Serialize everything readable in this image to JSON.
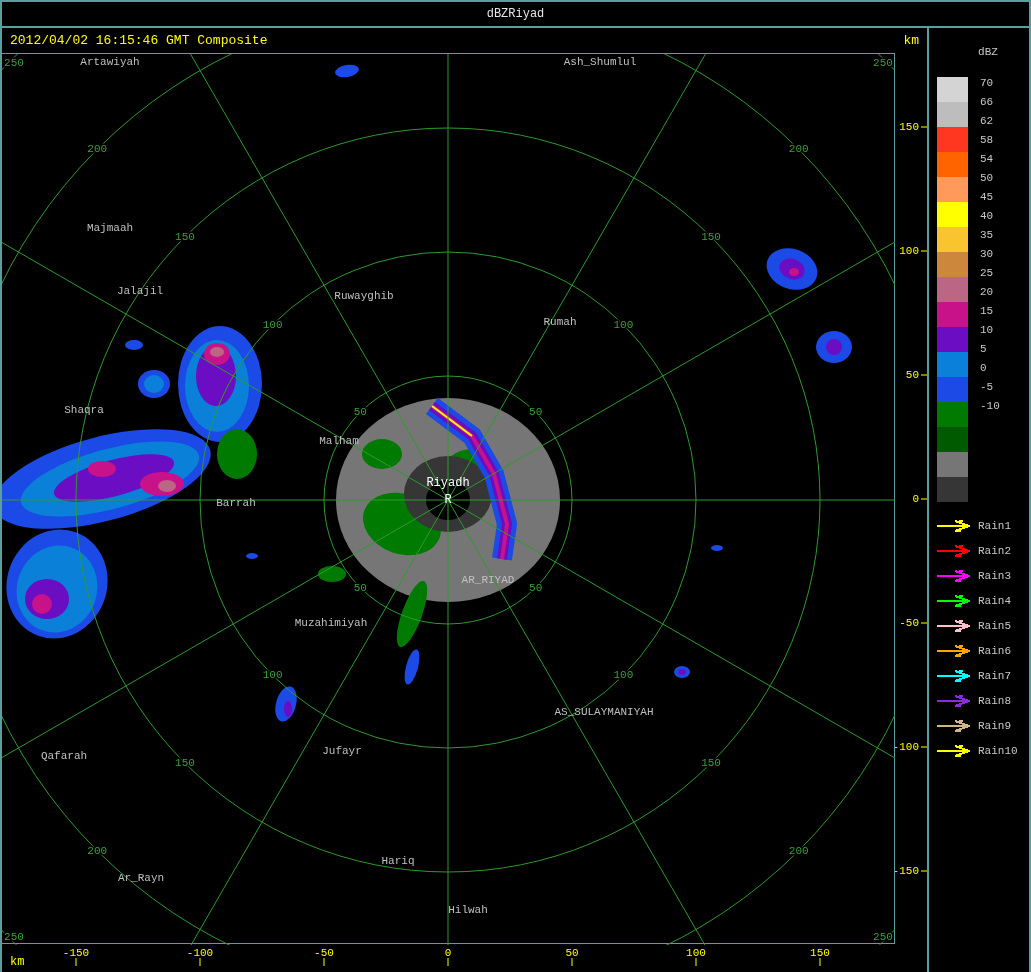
{
  "window": {
    "title": "dBZRiyad"
  },
  "header": {
    "timestamp": "2012/04/02 16:15:46 GMT Composite",
    "y_unit": "km"
  },
  "map": {
    "rings": [
      {
        "labels": [
          "50",
          "50",
          "50",
          "50"
        ]
      },
      {
        "labels": [
          "100",
          "100",
          "100",
          "100"
        ]
      },
      {
        "labels": [
          "150",
          "150",
          "150",
          "150"
        ]
      },
      {
        "labels": [
          "200",
          "200",
          "200",
          "200"
        ]
      },
      {
        "labels": [
          "250",
          "250",
          "250",
          "250"
        ]
      }
    ],
    "places": [
      {
        "name": "Artawiyah"
      },
      {
        "name": "Ash_Shumlul"
      },
      {
        "name": "Majmaah"
      },
      {
        "name": "Jalajil"
      },
      {
        "name": "Ruwayghib"
      },
      {
        "name": "Rumah"
      },
      {
        "name": "Shaqra"
      },
      {
        "name": "Malham"
      },
      {
        "name": "Barrah"
      },
      {
        "name": "AR_RIYAD"
      },
      {
        "name": "Muzahimiyah"
      },
      {
        "name": "AS_SULAYMANIYAH"
      },
      {
        "name": "Jufayr"
      },
      {
        "name": "Qafarah"
      },
      {
        "name": "Hariq"
      },
      {
        "name": "Ar_Rayn"
      },
      {
        "name": "Hilwah"
      }
    ],
    "radar_site": {
      "name": "Riyadh",
      "marker": "R"
    }
  },
  "y_axis": {
    "ticks": [
      "150",
      "100",
      "50",
      "0",
      "-50",
      "-100",
      "-150"
    ]
  },
  "x_axis": {
    "unit": "km",
    "ticks": [
      "-150",
      "-100",
      "-50",
      "0",
      "50",
      "100",
      "150"
    ]
  },
  "legend": {
    "unit": "dBZ",
    "levels": [
      {
        "color": "#d4d4d4"
      },
      {
        "color": "#bdbdbd"
      },
      {
        "color": "#ff3720"
      },
      {
        "color": "#ff6400"
      },
      {
        "color": "#ff9a5a"
      },
      {
        "color": "#ffff00"
      },
      {
        "color": "#f8c531"
      },
      {
        "color": "#cd873c"
      },
      {
        "color": "#bb6685"
      },
      {
        "color": "#c8128a"
      },
      {
        "color": "#6a0dc3"
      },
      {
        "color": "#0a80d8"
      },
      {
        "color": "#1b4ae6"
      },
      {
        "color": "#007a00"
      },
      {
        "color": "#005a00"
      },
      {
        "color": "#767676"
      },
      {
        "color": "#363636"
      }
    ],
    "ticks": [
      "70",
      "66",
      "62",
      "58",
      "54",
      "50",
      "45",
      "40",
      "35",
      "30",
      "25",
      "20",
      "15",
      "10",
      "5",
      "0",
      "-5",
      "-10"
    ],
    "tracks": [
      {
        "label": "Rain1",
        "color": "#ffff00"
      },
      {
        "label": "Rain2",
        "color": "#ff0000"
      },
      {
        "label": "Rain3",
        "color": "#ff00ff"
      },
      {
        "label": "Rain4",
        "color": "#00ff00"
      },
      {
        "label": "Rain5",
        "color": "#ffc0cb"
      },
      {
        "label": "Rain6",
        "color": "#ffa500"
      },
      {
        "label": "Rain7",
        "color": "#00ffff"
      },
      {
        "label": "Rain8",
        "color": "#8a2be2"
      },
      {
        "label": "Rain9",
        "color": "#d2b48c"
      },
      {
        "label": "Rain10",
        "color": "#ffff00"
      }
    ]
  }
}
